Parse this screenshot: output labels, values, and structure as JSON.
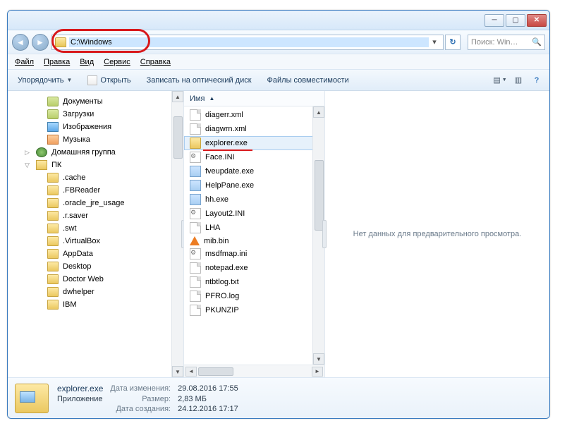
{
  "titlebar": {
    "min": "─",
    "max": "▢",
    "close": "✕"
  },
  "nav": {
    "path": "C:\\Windows",
    "refresh": "↻",
    "search_placeholder": "Поиск: Win…"
  },
  "menu": {
    "file": "Файл",
    "edit": "Правка",
    "view": "Вид",
    "tools": "Сервис",
    "help": "Справка"
  },
  "toolbar": {
    "organize": "Упорядочить",
    "open": "Открыть",
    "burn": "Записать на оптический диск",
    "compat": "Файлы совместимости"
  },
  "tree": [
    {
      "name": "Документы",
      "icon": "lib",
      "lvl": 1
    },
    {
      "name": "Загрузки",
      "icon": "lib",
      "lvl": 1
    },
    {
      "name": "Изображения",
      "icon": "img-i",
      "lvl": 1
    },
    {
      "name": "Музыка",
      "icon": "mus-i",
      "lvl": 1
    },
    {
      "name": "Домашняя группа",
      "icon": "hg",
      "lvl": 0,
      "exp": "▷"
    },
    {
      "name": "ПК",
      "icon": "pc",
      "lvl": 0,
      "exp": "▽"
    },
    {
      "name": ".cache",
      "icon": "folder",
      "lvl": 1
    },
    {
      "name": ".FBReader",
      "icon": "folder",
      "lvl": 1
    },
    {
      "name": ".oracle_jre_usage",
      "icon": "folder",
      "lvl": 1
    },
    {
      "name": ".r.saver",
      "icon": "folder",
      "lvl": 1
    },
    {
      "name": ".swt",
      "icon": "folder",
      "lvl": 1
    },
    {
      "name": ".VirtualBox",
      "icon": "folder",
      "lvl": 1
    },
    {
      "name": "AppData",
      "icon": "folder",
      "lvl": 1
    },
    {
      "name": "Desktop",
      "icon": "folder",
      "lvl": 1
    },
    {
      "name": "Doctor Web",
      "icon": "folder",
      "lvl": 1
    },
    {
      "name": "dwhelper",
      "icon": "folder",
      "lvl": 1
    },
    {
      "name": "IBM",
      "icon": "folder",
      "lvl": 1
    }
  ],
  "files": {
    "column": "Имя",
    "items": [
      {
        "name": "diagerr.xml",
        "ico": "doc-i"
      },
      {
        "name": "diagwrn.xml",
        "ico": "doc-i"
      },
      {
        "name": "explorer.exe",
        "ico": "folder",
        "sel": true,
        "underline": true
      },
      {
        "name": "Face.INI",
        "ico": "ini-i"
      },
      {
        "name": "fveupdate.exe",
        "ico": "exe-i"
      },
      {
        "name": "HelpPane.exe",
        "ico": "exe-i"
      },
      {
        "name": "hh.exe",
        "ico": "exe-i"
      },
      {
        "name": "Layout2.INI",
        "ico": "ini-i"
      },
      {
        "name": "LHA",
        "ico": "doc-i"
      },
      {
        "name": "mib.bin",
        "ico": "vlc-i"
      },
      {
        "name": "msdfmap.ini",
        "ico": "ini-i"
      },
      {
        "name": "notepad.exe",
        "ico": "doc-i"
      },
      {
        "name": "ntbtlog.txt",
        "ico": "doc-i"
      },
      {
        "name": "PFRO.log",
        "ico": "doc-i"
      },
      {
        "name": "PKUNZIP",
        "ico": "doc-i"
      }
    ]
  },
  "preview": {
    "empty": "Нет данных для предварительного просмотра."
  },
  "details": {
    "filename": "explorer.exe",
    "type": "Приложение",
    "modified_label": "Дата изменения:",
    "modified": "29.08.2016 17:55",
    "size_label": "Размер:",
    "size": "2,83 МБ",
    "created_label": "Дата создания:",
    "created": "24.12.2016 17:17"
  }
}
